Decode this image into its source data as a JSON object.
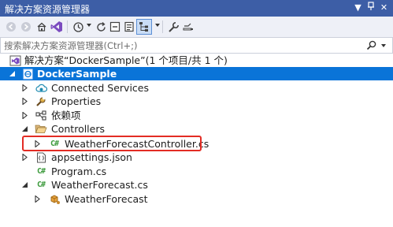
{
  "window": {
    "title": "解决方案资源管理器",
    "pin_glyph": "▼",
    "autohide_glyph": "Ꝑ",
    "close_glyph": "✕"
  },
  "toolbar": {
    "tools": [
      "back-icon",
      "forward-icon",
      "home-icon",
      "vs-icon",
      "history-icon",
      "refresh-icon",
      "collapse-all-icon",
      "sync-icon",
      "properties-icon",
      "preview-icon"
    ]
  },
  "search": {
    "placeholder": "搜索解决方案资源管理器(Ctrl+;)"
  },
  "tree": {
    "solution_label": "解决方案“DockerSample”(1 个项目/共 1 个)",
    "project_label": "DockerSample",
    "connected_services": "Connected Services",
    "properties": "Properties",
    "dependencies": "依赖项",
    "controllers": "Controllers",
    "controller_file": "WeatherForecastController.cs",
    "cs_badge": "C#",
    "appsettings": "appsettings.json",
    "program": "Program.cs",
    "weatherforecast_file": "WeatherForecast.cs",
    "weatherforecast_class": "WeatherForecast"
  },
  "colors": {
    "titlebar": "#3d5ea6",
    "selection": "#0a74d8",
    "highlight_border": "#e32c24",
    "cs_icon": "#3b9a3b"
  }
}
